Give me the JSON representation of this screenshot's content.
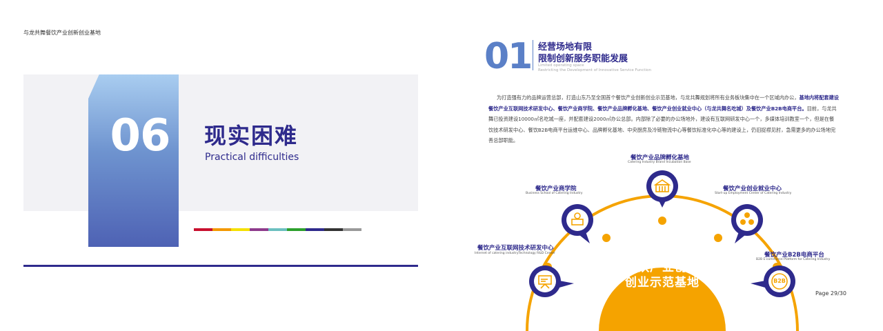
{
  "header": {
    "text": "与龙共舞餐饮产业创新创业基地"
  },
  "left": {
    "chapter_number": "06",
    "title_cn": "现实困难",
    "title_en": "Practical difficulties",
    "color_strip": [
      "#c8102e",
      "#f39800",
      "#f5e000",
      "#8e3b8c",
      "#6cc0c0",
      "#2ca02c",
      "#2e2a8c",
      "#333333",
      "#999999"
    ]
  },
  "section": {
    "number": "01",
    "title_line1": "经营场地有限",
    "title_line2": "限制创新服务职能发展",
    "subtitle_en1": "Limited operating space",
    "subtitle_en2": "Restricting the Development of Innovative Service Function"
  },
  "paragraph": {
    "part1": "为打造强有力的品牌运营总部，打造山东乃至全国首个餐饮产业创新创业示范基地，与龙共舞规划将所有业务板块集中在一个区域内办公，",
    "part2": "基地内将配套建设餐饮产业互联网技术研发中心、餐饮产业商学院、餐饮产业品牌孵化基地、餐饮产业创业就业中心（与龙共舞名吃城）及餐饮产业B2B电商平台。",
    "part3": "目前，与龙共舞已投资建设10000㎡名吃城一座，并配套建设2000㎡办公总部。内部除了必要的办公场地外，建设有互联网研发中心一个，多媒体培训教室一个，但是在餐饮技术研发中心、餐饮B2B电商平台运维中心、品牌孵化基地、中央厨房及冷链物流中心等餐饮标准化中心等的建设上，仍旧捉襟见肘，急需更多的办公场地完善总部职能。"
  },
  "diagram": {
    "hub_line1": "餐饮产业创新",
    "hub_line2": "创业示范基地",
    "nodes": [
      {
        "cn": "餐饮产业互联网技术研发中心",
        "en": "Internet of catering industryTechnology R&D Center",
        "icon": "presentation-board-icon"
      },
      {
        "cn": "餐饮产业商学院",
        "en": "Business School of Catering Industry",
        "icon": "books-icon"
      },
      {
        "cn": "餐饮产业品牌孵化基地",
        "en": "Catering Industry Brand Incubation Base",
        "icon": "building-icon"
      },
      {
        "cn": "餐饮产业创业就业中心",
        "en": "Start-up Employment Center of Catering Industry",
        "icon": "people-icon"
      },
      {
        "cn": "餐饮产业B2B电商平台",
        "en": "B2B E-commerce Platform for Catering Industry",
        "icon": "b2b-icon"
      }
    ],
    "b2b_badge": "B2B",
    "colors": {
      "navy": "#2e2a8c",
      "orange": "#f5a300"
    }
  },
  "footer": {
    "page_label": "Page  29/30"
  }
}
